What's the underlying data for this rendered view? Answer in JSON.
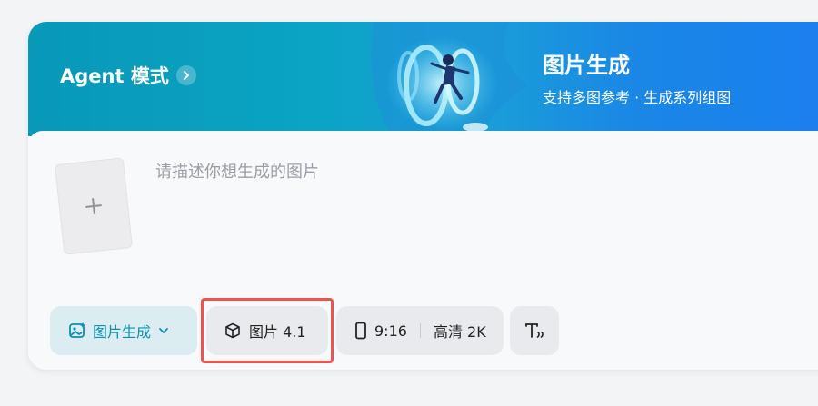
{
  "banner": {
    "agent_label": "Agent 模式",
    "title": "图片生成",
    "subtitle": "支持多图参考 · 生成系列组图",
    "gradient_colors": [
      "#0898b8",
      "#1b7ff0"
    ]
  },
  "composer": {
    "placeholder": "请描述你想生成的图片",
    "upload_icon": "plus-icon"
  },
  "toolbar": {
    "mode_label": "图片生成",
    "model_label": "图片 4.1",
    "ratio_label": "9:16",
    "quality_label": "高清 2K",
    "text_tool_icon": "text-format-icon",
    "highlight_color": "#ef5350",
    "accent_color": "#0f8fae"
  }
}
